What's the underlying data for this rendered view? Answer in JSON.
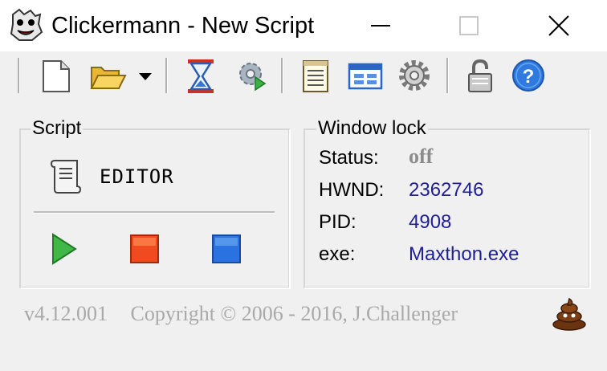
{
  "window": {
    "title": "Clickermann - New Script",
    "app_icon": "clickermann-face-icon",
    "controls": [
      "minimize-icon",
      "maximize-icon",
      "close-icon"
    ]
  },
  "toolbar": {
    "items": [
      {
        "name": "new-file-icon"
      },
      {
        "name": "open-folder-icon"
      },
      {
        "name": "dropdown-arrow-icon"
      },
      {
        "name": "hourglass-icon"
      },
      {
        "name": "gear-play-icon"
      },
      {
        "name": "notepad-icon"
      },
      {
        "name": "window-icon"
      },
      {
        "name": "settings-gear-icon"
      },
      {
        "name": "padlock-icon"
      },
      {
        "name": "help-icon"
      }
    ]
  },
  "script_panel": {
    "label": "Script",
    "editor_label": "EDITOR",
    "editor_icon": "scroll-icon",
    "play_icon": "play-icon",
    "stop_icon": "stop-icon",
    "record_icon": "blue-square-icon"
  },
  "window_lock": {
    "label": "Window lock",
    "status_label": "Status:",
    "status_value": "off",
    "hwnd_label": "HWND:",
    "hwnd_value": "2362746",
    "pid_label": "PID:",
    "pid_value": "4908",
    "exe_label": "exe:",
    "exe_value": "Maxthon.exe"
  },
  "footer": {
    "version": "v4.12.001",
    "copyright": "Copyright © 2006 - 2016, J.Challenger",
    "mascot_icon": "poop-icon"
  },
  "colors": {
    "value_text": "#1e1e96",
    "status_off": "#8c8c8c",
    "footer_text": "#a9a9a9"
  }
}
